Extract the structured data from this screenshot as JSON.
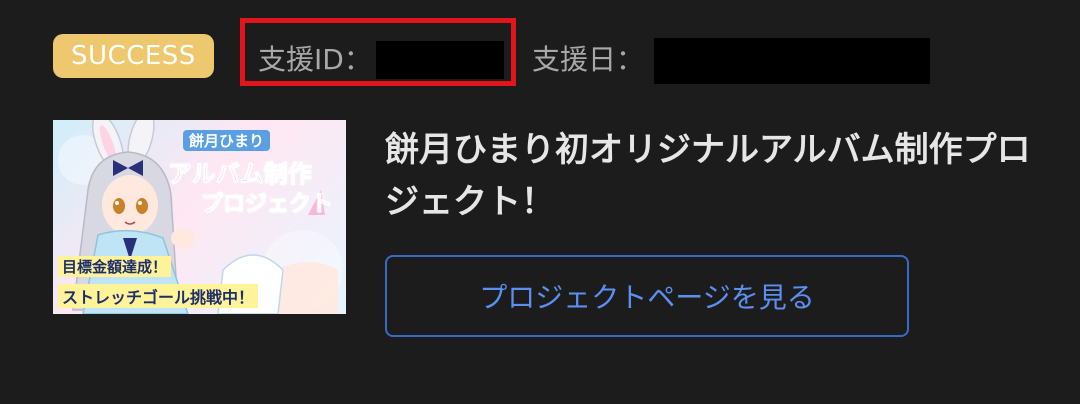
{
  "status": {
    "badge_label": "SUCCESS",
    "badge_color": "#edc86f",
    "support_id_label": "支援ID：",
    "support_date_label": "支援日："
  },
  "project": {
    "thumbnail": {
      "title_line1": "餅月ひまり",
      "title_line2": "アルバム制作",
      "title_line3": "プロジェクト",
      "goal_line1": "目標金額達成！",
      "goal_line2": "ストレッチゴール挑戦中！"
    },
    "title": "餅月ひまり初オリジナルアルバム制作プロジェクト！",
    "button_label": "プロジェクトページを見る"
  },
  "colors": {
    "background": "#1c1c1d",
    "highlight_box": "#e0161b",
    "button_text": "#5b8ff0",
    "button_border": "#3a6bc4"
  }
}
